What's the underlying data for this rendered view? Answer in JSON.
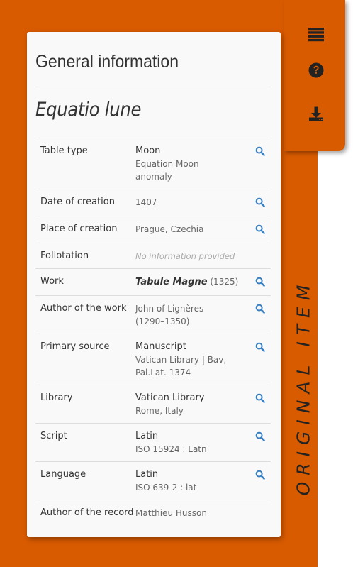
{
  "side_panel": {
    "vertical_title": "ORIGINAL ITEM",
    "icons": [
      "list-icon",
      "help-icon",
      "download-icon"
    ]
  },
  "card": {
    "heading": "General information",
    "title": "Equatio lune",
    "rows": [
      {
        "label": "Table type",
        "main": "Moon",
        "sub1": "Equation Moon",
        "sub2": "anomaly"
      },
      {
        "label": "Date of creation",
        "value": "1407"
      },
      {
        "label": "Place of creation",
        "value": "Prague, Czechia"
      },
      {
        "label": "Foliotation",
        "value": "No information provided"
      },
      {
        "label": "Work",
        "title": "Tabule Magne",
        "suffix": "(1325)"
      },
      {
        "label": "Author of the work",
        "line1": "John of Lignères",
        "line2": "(1290–1350)"
      },
      {
        "label": "Primary source",
        "main": "Manuscript",
        "sub1": "Vatican Library | Bav,",
        "sub2": "Pal.Lat. 1374"
      },
      {
        "label": "Library",
        "main": "Vatican Library",
        "sub1": "Rome, Italy"
      },
      {
        "label": "Script",
        "main": "Latin",
        "sub1": "ISO 15924 : Latn"
      },
      {
        "label": "Language",
        "main": "Latin",
        "sub1": "ISO 639-2 : lat"
      },
      {
        "label": "Author of the record",
        "value": "Matthieu Husson"
      }
    ]
  },
  "colors": {
    "accent": "#d95b00",
    "search_icon": "#3a7fc1"
  }
}
